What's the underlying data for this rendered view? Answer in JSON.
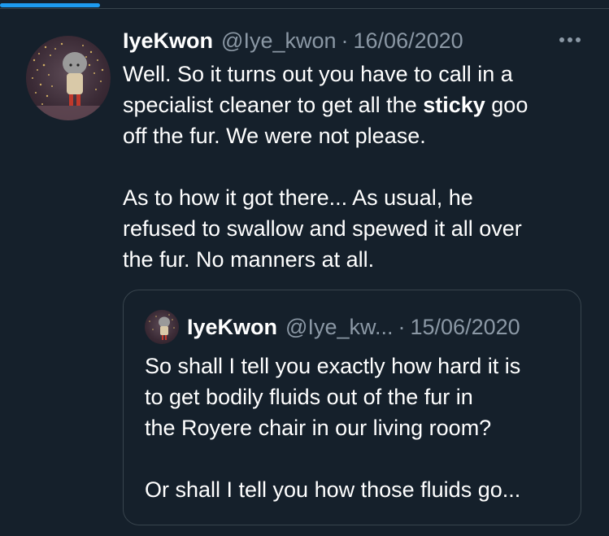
{
  "tweet": {
    "display_name": "IyeKwon",
    "handle": "@Iye_kwon",
    "separator": "·",
    "date": "16/06/2020",
    "lines_para1": [
      "Well. So it turns out you have to call in a",
      "specialist cleaner to get all the ",
      "sticky",
      " goo",
      "off the fur. We were not please."
    ],
    "lines_para2": [
      "As to how it got there... As usual, he",
      "refused to swallow and spewed it all over",
      "the fur. No manners at all."
    ],
    "more_icon": "more-horizontal-icon"
  },
  "quote": {
    "display_name": "IyeKwon",
    "handle": "@Iye_kw...",
    "separator": "·",
    "date": "15/06/2020",
    "lines_para1": [
      "So shall I tell you exactly how hard it is",
      "to get bodily  fluids out of the fur in",
      "the Royere chair in our living room?"
    ],
    "lines_para2": [
      "Or shall I tell you how those fluids go..."
    ]
  },
  "colors": {
    "background": "#15202b",
    "text": "#ffffff",
    "secondary_text": "#8b98a5",
    "border": "#38444d",
    "accent": "#1d9bf0"
  }
}
